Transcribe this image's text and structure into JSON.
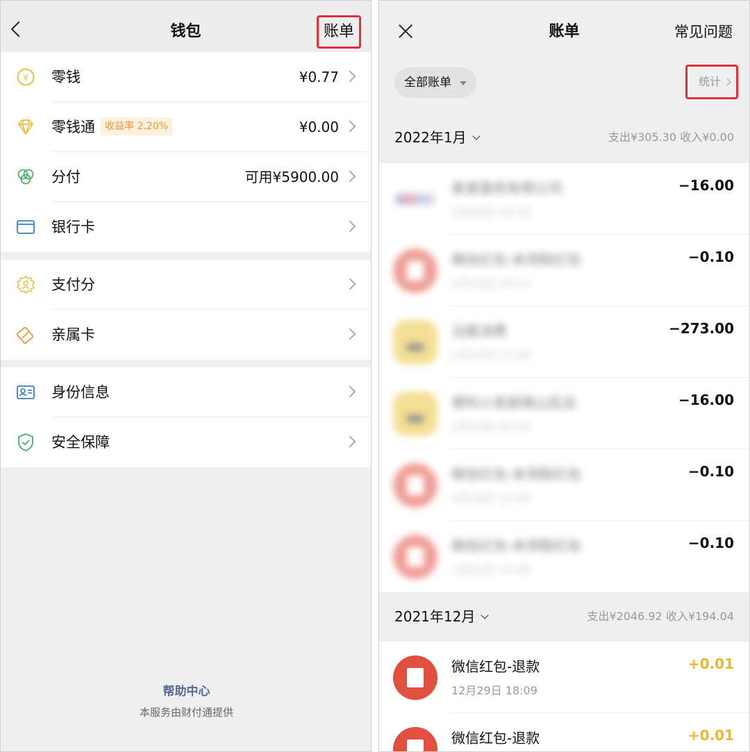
{
  "wallet": {
    "title": "钱包",
    "bill_button": "账单",
    "items": [
      {
        "label": "零钱",
        "value": "¥0.77",
        "icon": "yuan-coin-icon",
        "color": "#e8c245"
      },
      {
        "label": "零钱通",
        "badge": "收益率 2.20%",
        "value": "¥0.00",
        "icon": "diamond-icon",
        "color": "#e8c245"
      },
      {
        "label": "分付",
        "value": "可用¥5900.00",
        "icon": "fenfu-icon",
        "color": "#4cae6e"
      },
      {
        "label": "银行卡",
        "value": "",
        "icon": "bank-card-icon",
        "color": "#3c7ec2"
      },
      {
        "label": "支付分",
        "value": "",
        "icon": "pay-score-icon",
        "color": "#e8c245"
      },
      {
        "label": "亲属卡",
        "value": "",
        "icon": "family-card-icon",
        "color": "#e89b3a"
      },
      {
        "label": "身份信息",
        "value": "",
        "icon": "id-card-icon",
        "color": "#3c7ec2"
      },
      {
        "label": "安全保障",
        "value": "",
        "icon": "shield-icon",
        "color": "#4cae6e"
      }
    ],
    "help_center": "帮助中心",
    "provided_by": "本服务由财付通提供"
  },
  "bill": {
    "title": "账单",
    "faq": "常见问题",
    "filter": "全部账单",
    "stats": "统计",
    "months": [
      {
        "month": "2022年1月",
        "summary": "支出¥305.30   收入¥0.00",
        "transactions": [
          {
            "name": "麦麦服务有限公司",
            "time": "1月26日 18:35",
            "amount": "−16.00",
            "avatar": "logo",
            "blurred": true
          },
          {
            "name": "微信红包-未领取红包",
            "time": "1月25日 16:12",
            "amount": "−0.10",
            "avatar": "red",
            "blurred": true
          },
          {
            "name": "沿路消费",
            "time": "1月23日 17:34",
            "amount": "−273.00",
            "avatar": "yel",
            "blurred": true
          },
          {
            "name": "便利小卖部南山区店",
            "time": "1月20日 09:30",
            "amount": "−16.00",
            "avatar": "yel",
            "blurred": true
          },
          {
            "name": "微信红包-未领取红包",
            "time": "1月18日 12:49",
            "amount": "−0.10",
            "avatar": "red",
            "blurred": true
          },
          {
            "name": "微信红包-未领取红包",
            "time": "1月11日 15:08",
            "amount": "−0.10",
            "avatar": "red",
            "blurred": true
          }
        ]
      },
      {
        "month": "2021年12月",
        "summary": "支出¥2046.92   收入¥194.04",
        "transactions": [
          {
            "name": "微信红包-退款",
            "time": "12月29日 18:09",
            "amount": "+0.01",
            "avatar": "red",
            "blurred": false
          },
          {
            "name": "微信红包-退款",
            "time": "",
            "amount": "+0.01",
            "avatar": "red",
            "blurred": false
          }
        ]
      }
    ]
  }
}
